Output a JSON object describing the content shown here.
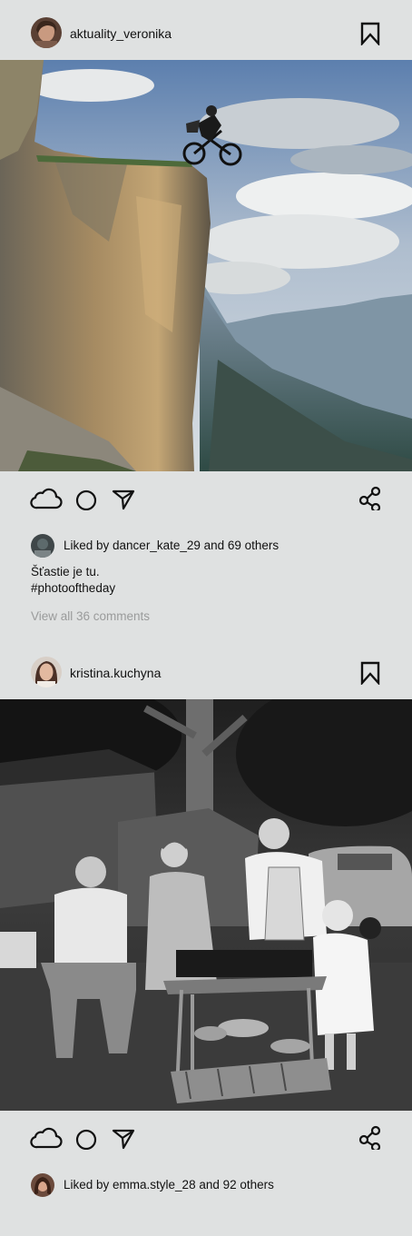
{
  "posts": [
    {
      "username": "aktuality_veronika",
      "avatar_icon": "user-avatar",
      "photo_alt": "Mountain biker on a cliff edge above a valley",
      "liked_by": "Liked by dancer_kate_29 and 69 others",
      "caption_line1": "Šťastie je tu.",
      "caption_line2": "#photooftheday",
      "view_comments": "View all 36 comments"
    },
    {
      "username": "kristina.kuchyna",
      "avatar_icon": "user-avatar",
      "photo_alt": "Vintage black and white photo of a family grilling outdoors",
      "liked_by": "Liked by emma.style_28 and 92 others"
    }
  ],
  "icons": {
    "like": "cloud-icon",
    "comment": "circle-icon",
    "send": "send-icon",
    "share": "share-icon",
    "save": "bookmark-icon"
  },
  "colors": {
    "background": "#dfe1e1",
    "text": "#111111",
    "muted": "#9a9b9b"
  }
}
